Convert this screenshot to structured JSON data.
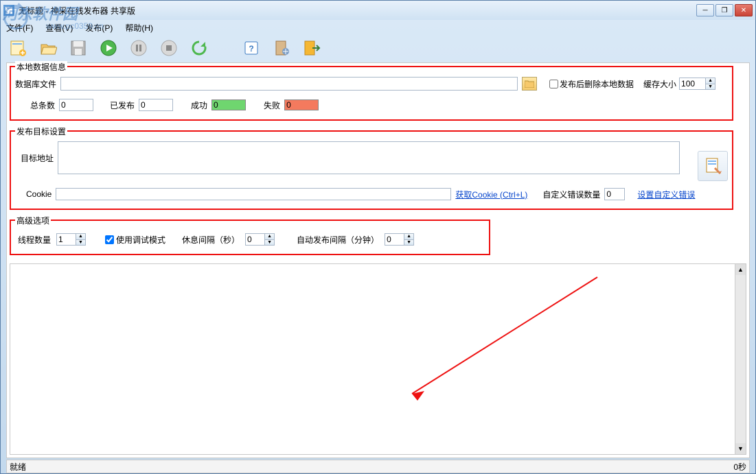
{
  "title": "无标题 - 神采在线发布器 共享版",
  "watermark": {
    "text1": "河东软件园",
    "text2": "www.pc0359.cn"
  },
  "menu": {
    "file": "文件(F)",
    "view": "查看(V)",
    "publish": "发布(P)",
    "help": "帮助(H)"
  },
  "section1": {
    "legend": "本地数据信息",
    "dbfile_label": "数据库文件",
    "dbfile_value": "",
    "delete_after_label": "发布后删除本地数据",
    "cache_label": "缓存大小",
    "cache_value": "100",
    "total_label": "总条数",
    "total_value": "0",
    "published_label": "已发布",
    "published_value": "0",
    "success_label": "成功",
    "success_value": "0",
    "fail_label": "失败",
    "fail_value": "0"
  },
  "section2": {
    "legend": "发布目标设置",
    "target_label": "目标地址",
    "target_value": "",
    "cookie_label": "Cookie",
    "cookie_value": "",
    "get_cookie_link": "获取Cookie (Ctrl+L)",
    "error_count_label": "自定义错误数量",
    "error_count_value": "0",
    "set_error_link": "设置自定义错误"
  },
  "section3": {
    "legend": "高级选项",
    "threads_label": "线程数量",
    "threads_value": "1",
    "debug_label": "使用调试模式",
    "rest_label": "休息间隔（秒）",
    "rest_value": "0",
    "auto_label": "自动发布间隔（分钟）",
    "auto_value": "0"
  },
  "status": {
    "left": "就绪",
    "right": "0秒"
  }
}
